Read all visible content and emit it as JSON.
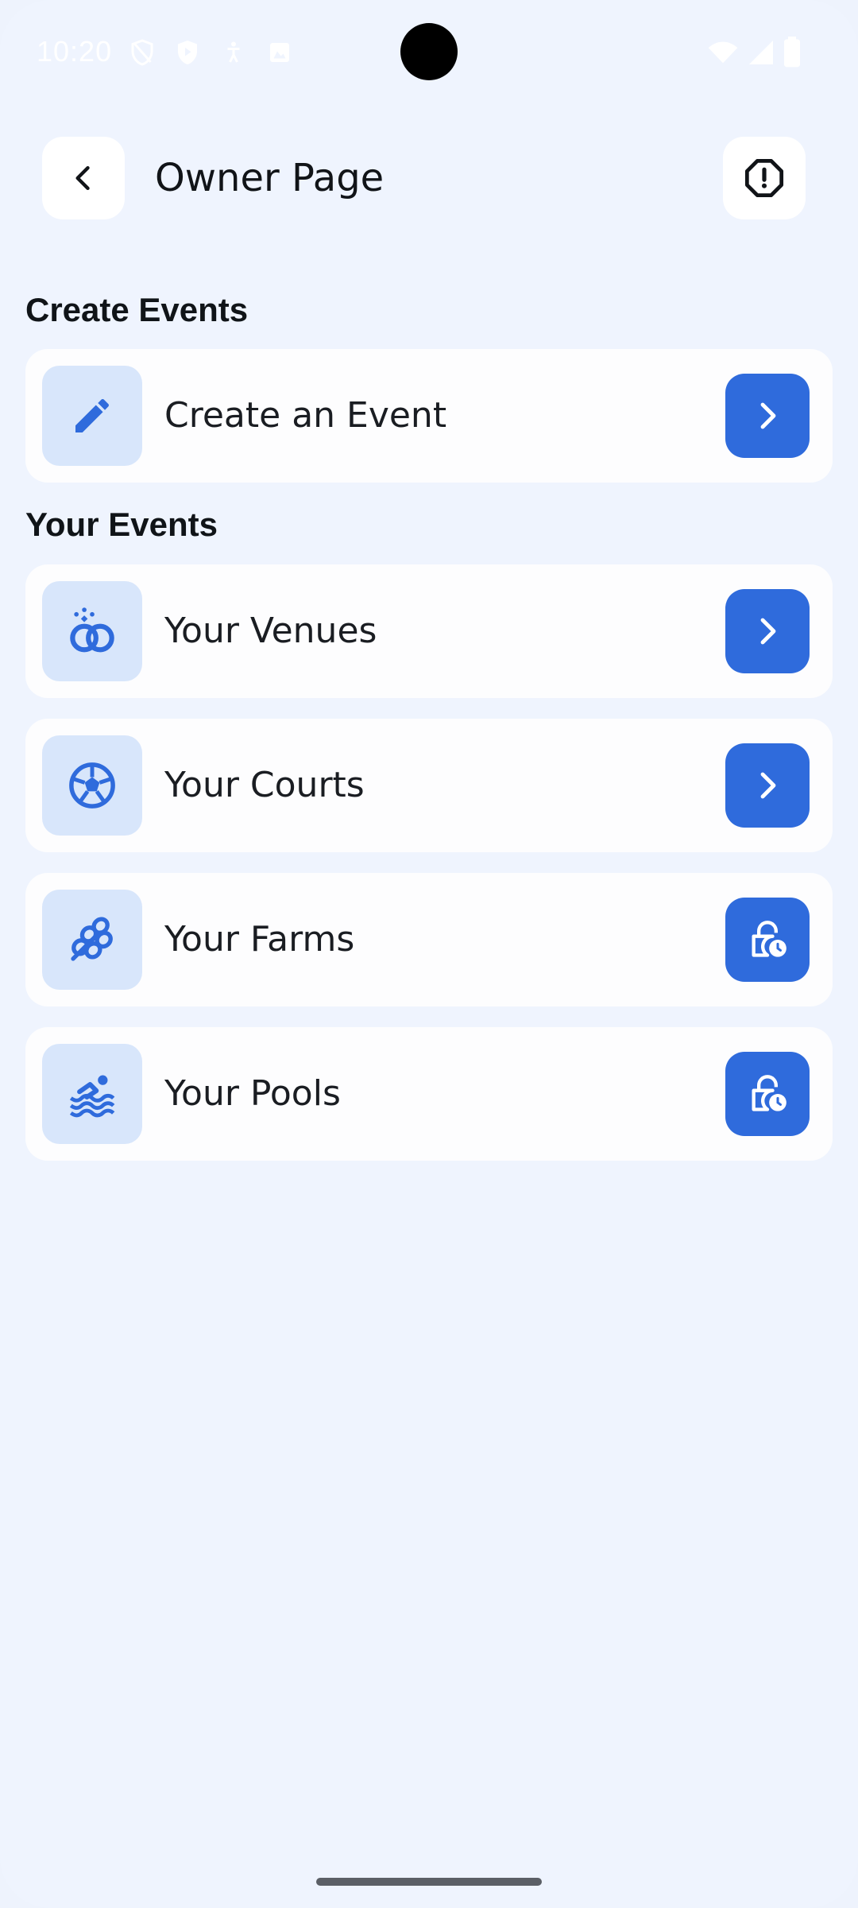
{
  "status_bar": {
    "time": "10:20",
    "icons": [
      "shield-outline-icon",
      "shield-play-icon",
      "accessibility-icon",
      "image-icon",
      "wifi-icon",
      "signal-icon",
      "battery-icon"
    ]
  },
  "header": {
    "title": "Owner Page",
    "back_icon": "chevron-left-icon",
    "report_icon": "octagon-alert-icon"
  },
  "sections": {
    "create": {
      "title": "Create Events",
      "items": [
        {
          "label": "Create an Event",
          "icon": "pencil-icon",
          "action_icon": "chevron-right-icon"
        }
      ]
    },
    "yours": {
      "title": "Your Events",
      "items": [
        {
          "label": "Your Venues",
          "icon": "rings-icon",
          "action_icon": "chevron-right-icon"
        },
        {
          "label": "Your Courts",
          "icon": "soccer-ball-icon",
          "action_icon": "chevron-right-icon"
        },
        {
          "label": "Your Farms",
          "icon": "grain-icon",
          "action_icon": "lock-clock-icon"
        },
        {
          "label": "Your Pools",
          "icon": "swimmer-icon",
          "action_icon": "lock-clock-icon"
        }
      ]
    }
  },
  "colors": {
    "background": "#eff4fe",
    "card": "#fdfdfe",
    "icon_box": "#d8e6fb",
    "accent": "#2f6bdc",
    "text": "#101418"
  }
}
